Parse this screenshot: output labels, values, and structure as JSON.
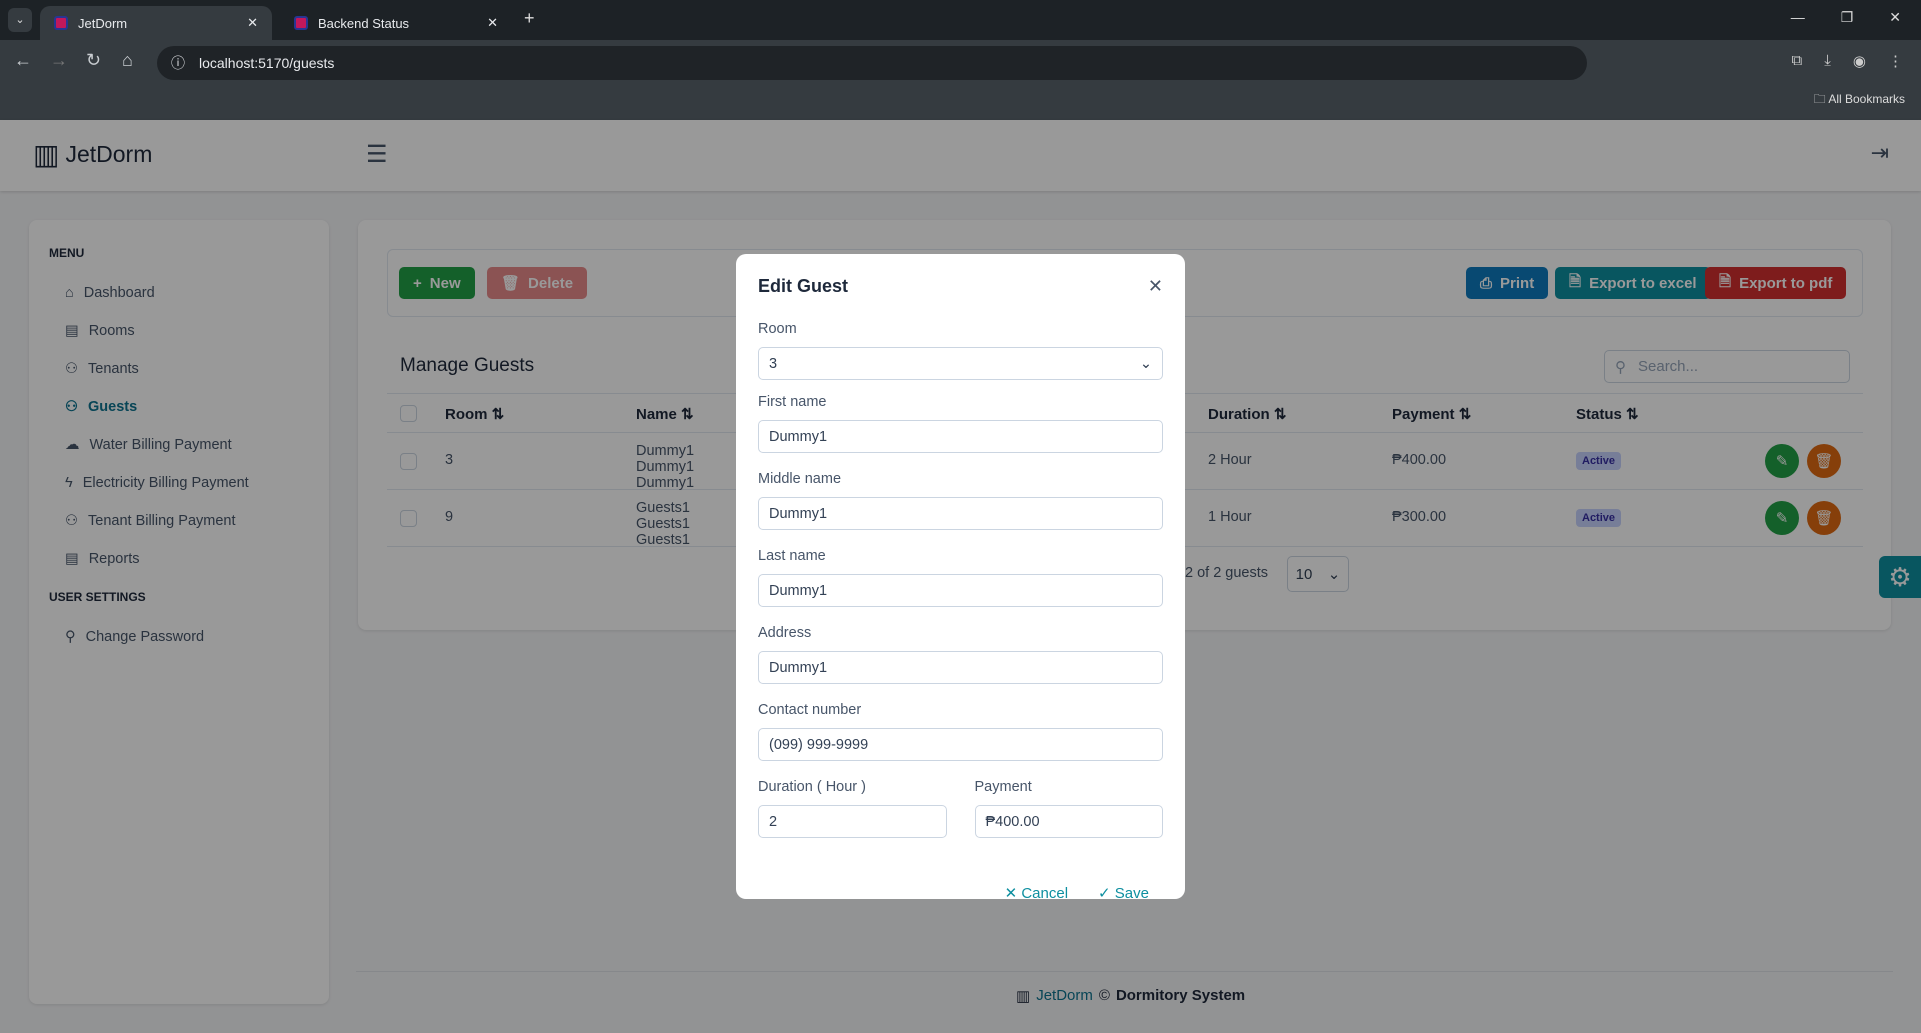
{
  "browser": {
    "tabs": [
      {
        "title": "JetDorm"
      },
      {
        "title": "Backend Status"
      }
    ],
    "url": "localhost:5170/guests",
    "bookmarks": "All Bookmarks"
  },
  "app": {
    "brand": "JetDorm"
  },
  "sidebar": {
    "menu_title": "MENU",
    "items": [
      {
        "label": "Dashboard",
        "icon": "home-icon"
      },
      {
        "label": "Rooms",
        "icon": "building-icon"
      },
      {
        "label": "Tenants",
        "icon": "users-icon"
      },
      {
        "label": "Guests",
        "icon": "users-icon",
        "active": true
      },
      {
        "label": "Water Billing Payment",
        "icon": "cloud-icon"
      },
      {
        "label": "Electricity Billing Payment",
        "icon": "bolt-icon"
      },
      {
        "label": "Tenant Billing Payment",
        "icon": "users-icon"
      },
      {
        "label": "Reports",
        "icon": "book-icon"
      }
    ],
    "settings_title": "USER SETTINGS",
    "settings_items": [
      {
        "label": "Change Password",
        "icon": "user-edit-icon"
      }
    ]
  },
  "toolbar": {
    "new": "New",
    "delete": "Delete",
    "print": "Print",
    "excel": "Export to excel",
    "pdf": "Export to pdf"
  },
  "colors": {
    "green": "#22a046",
    "red": "#dc2f2f",
    "print": "#0e7bbf",
    "excel": "#0e8fa0",
    "accent": "#0e7490"
  },
  "table": {
    "title": "Manage Guests",
    "search_placeholder": "Search...",
    "headers": {
      "room": "Room",
      "name": "Name",
      "duration": "Duration",
      "payment": "Payment",
      "status": "Status"
    },
    "rows": [
      {
        "room": "3",
        "name": "Dummy1 Dummy1 Dummy1",
        "duration": "2 Hour",
        "payment": "₱400.00",
        "status": "Active"
      },
      {
        "room": "9",
        "name": "Guests1 Guests1 Guests1",
        "duration": "1 Hour",
        "payment": "₱300.00",
        "status": "Active"
      }
    ],
    "pagination_text": "2 of 2 guests",
    "rows_per_page": "10"
  },
  "modal": {
    "title": "Edit Guest",
    "room_label": "Room",
    "room": "3",
    "first_label": "First name",
    "first": "Dummy1",
    "middle_label": "Middle name",
    "middle": "Dummy1",
    "last_label": "Last name",
    "last": "Dummy1",
    "address_label": "Address",
    "address": "Dummy1",
    "contact_label": "Contact number",
    "contact": "(099) 999-9999",
    "duration_label": "Duration ( Hour )",
    "duration": "2",
    "payment_label": "Payment",
    "payment": "₱400.00",
    "cancel": "Cancel",
    "save": "Save"
  },
  "footer": {
    "brand": "JetDorm",
    "copy": "©",
    "system": "Dormitory System"
  }
}
